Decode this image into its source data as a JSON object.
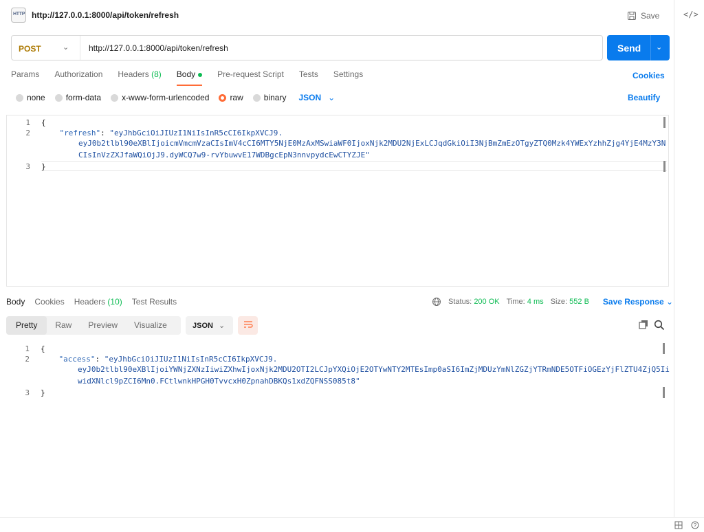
{
  "header": {
    "title": "http://127.0.0.1:8000/api/token/refresh",
    "badge": "HTTP",
    "save_label": "Save",
    "code_icon": "</>"
  },
  "request": {
    "method": "POST",
    "url": "http://127.0.0.1:8000/api/token/refresh",
    "send_label": "Send"
  },
  "tabs": [
    {
      "label": "Params"
    },
    {
      "label": "Authorization"
    },
    {
      "label": "Headers",
      "count": "(8)"
    },
    {
      "label": "Body"
    },
    {
      "label": "Pre-request Script"
    },
    {
      "label": "Tests"
    },
    {
      "label": "Settings"
    }
  ],
  "cookies_label": "Cookies",
  "body_types": [
    "none",
    "form-data",
    "x-www-form-urlencoded",
    "raw",
    "binary"
  ],
  "body_format": "JSON",
  "beautify_label": "Beautify",
  "request_body": {
    "line_numbers": [
      "1",
      "2",
      "3"
    ],
    "open": "{",
    "key": "\"refresh\"",
    "colon": ": ",
    "value_lines": [
      "\"eyJhbGciOiJIUzI1NiIsInR5cCI6IkpXVCJ9.",
      "eyJ0b2tlbl90eXBlIjoicmVmcmVzaCIsImV4cCI6MTY5NjE0MzAxMSwiaWF0IjoxNjk2MDU2NjExLCJqdGkiOiI3NjBmZmEzOTgyZTQ0Mzk4YWExYzhhZjg4YjE4MzY3N",
      "CIsInVzZXJfaWQiOjJ9.dyWCQ7w9-rvYbuwvE17WDBgcEpN3nnvpydcEwCTYZJE\""
    ],
    "close": "}"
  },
  "response": {
    "tabs": [
      {
        "label": "Body"
      },
      {
        "label": "Cookies"
      },
      {
        "label": "Headers",
        "count": "(10)"
      },
      {
        "label": "Test Results"
      }
    ],
    "status_label": "Status:",
    "status_value": "200 OK",
    "time_label": "Time:",
    "time_value": "4 ms",
    "size_label": "Size:",
    "size_value": "552 B",
    "save_label": "Save Response",
    "views": [
      "Pretty",
      "Raw",
      "Preview",
      "Visualize"
    ],
    "format": "JSON",
    "body": {
      "line_numbers": [
        "1",
        "2",
        "3"
      ],
      "open": "{",
      "key": "\"access\"",
      "colon": ": ",
      "value_lines": [
        "\"eyJhbGciOiJIUzI1NiIsInR5cCI6IkpXVCJ9.",
        "eyJ0b2tlbl90eXBlIjoiYWNjZXNzIiwiZXhwIjoxNjk2MDU2OTI2LCJpYXQiOjE2OTYwNTY2MTEsImp0aSI6ImZjMDUzYmNlZGZjYTRmNDE5OTFiOGEzYjFlZTU4ZjQ5Ii",
        "widXNlcl9pZCI6Mn0.FCtlwnkHPGH0TvvcxH0ZpnahDBKQs1xdZQFNSS085t8\""
      ],
      "close": "}"
    }
  }
}
